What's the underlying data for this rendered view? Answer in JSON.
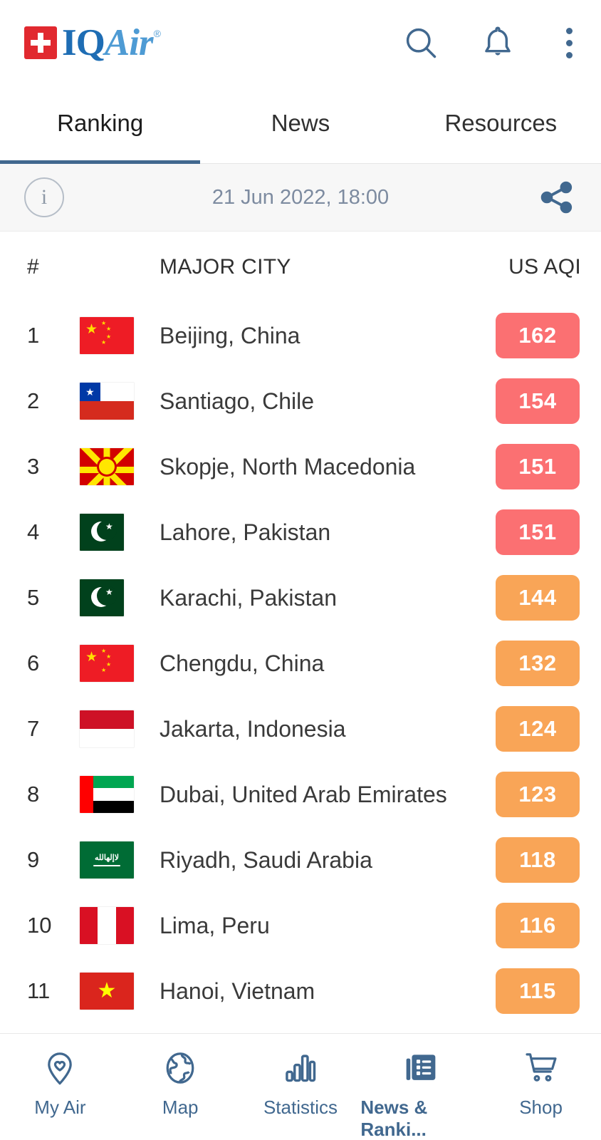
{
  "brand": {
    "name_part1": "IQ",
    "name_part2": "Air",
    "trademark": "®"
  },
  "header": {
    "icons": {
      "search": "search-icon",
      "bell": "notifications-icon",
      "menu": "more-options-icon"
    }
  },
  "tabs": [
    {
      "label": "Ranking",
      "active": true
    },
    {
      "label": "News",
      "active": false
    },
    {
      "label": "Resources",
      "active": false
    }
  ],
  "datebar": {
    "info_label": "i",
    "timestamp": "21 Jun 2022, 18:00",
    "share_label": "share-icon"
  },
  "table": {
    "headers": {
      "rank": "#",
      "city": "MAJOR CITY",
      "aqi": "US AQI"
    },
    "rows": [
      {
        "rank": "1",
        "flag": "cn",
        "city": "Beijing, China",
        "aqi": "162",
        "level": "red"
      },
      {
        "rank": "2",
        "flag": "cl",
        "city": "Santiago, Chile",
        "aqi": "154",
        "level": "red"
      },
      {
        "rank": "3",
        "flag": "mk",
        "city": "Skopje, North Macedonia",
        "aqi": "151",
        "level": "red"
      },
      {
        "rank": "4",
        "flag": "pk",
        "city": "Lahore, Pakistan",
        "aqi": "151",
        "level": "red"
      },
      {
        "rank": "5",
        "flag": "pk",
        "city": "Karachi, Pakistan",
        "aqi": "144",
        "level": "orange"
      },
      {
        "rank": "6",
        "flag": "cn",
        "city": "Chengdu, China",
        "aqi": "132",
        "level": "orange"
      },
      {
        "rank": "7",
        "flag": "id",
        "city": "Jakarta, Indonesia",
        "aqi": "124",
        "level": "orange"
      },
      {
        "rank": "8",
        "flag": "ae",
        "city": "Dubai, United Arab Emirates",
        "aqi": "123",
        "level": "orange"
      },
      {
        "rank": "9",
        "flag": "sa",
        "city": "Riyadh, Saudi Arabia",
        "aqi": "118",
        "level": "orange"
      },
      {
        "rank": "10",
        "flag": "pe",
        "city": "Lima, Peru",
        "aqi": "116",
        "level": "orange"
      },
      {
        "rank": "11",
        "flag": "vn",
        "city": "Hanoi, Vietnam",
        "aqi": "115",
        "level": "orange"
      }
    ]
  },
  "bottom_nav": [
    {
      "label": "My Air",
      "icon": "location-heart-icon",
      "active": false
    },
    {
      "label": "Map",
      "icon": "globe-icon",
      "active": false
    },
    {
      "label": "Statistics",
      "icon": "bar-chart-icon",
      "active": false
    },
    {
      "label": "News & Ranki...",
      "icon": "newspaper-icon",
      "active": true
    },
    {
      "label": "Shop",
      "icon": "cart-icon",
      "active": false
    }
  ],
  "colors": {
    "brand_blue_dark": "#1E6DB4",
    "brand_blue_light": "#4E9BD4",
    "accent_steel": "#41688F",
    "aqi_red": "#FB7072",
    "aqi_orange": "#F9A557",
    "swiss_red": "#E1292F",
    "date_text": "#7d8ba0"
  }
}
